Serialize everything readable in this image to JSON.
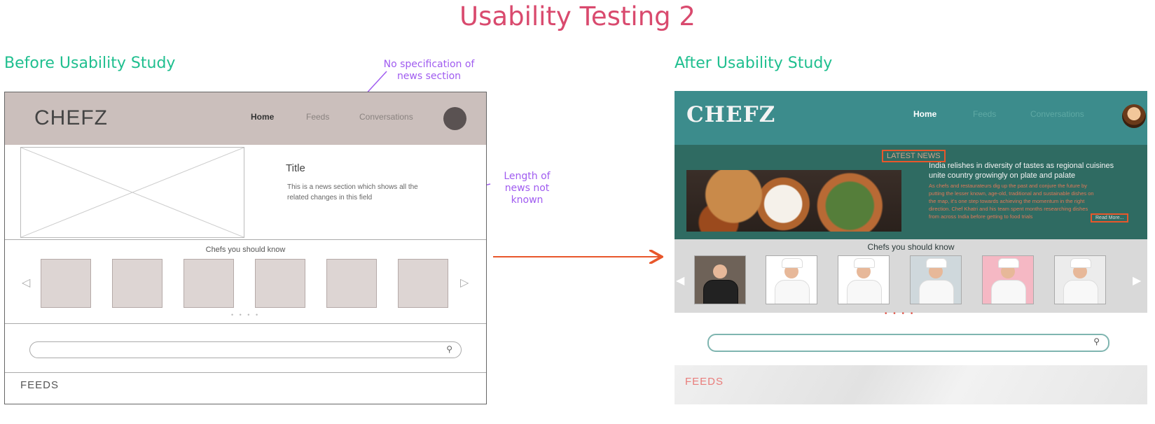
{
  "page_title": "Usability Testing 2",
  "before": {
    "heading": "Before Usability Study",
    "logo": "CHEFZ",
    "nav": [
      "Home",
      "Feeds",
      "Conversations"
    ],
    "news_title": "Title",
    "news_body": "This is a news section which shows all the related changes in this field",
    "chefs_title": "Chefs you should know",
    "dots": "• • • •",
    "feeds_label": "FEEDS"
  },
  "annotations": {
    "no_spec": "No specification of news section",
    "length": "Length of news not known"
  },
  "after": {
    "heading": "After Usability Study",
    "logo": "CHEFZ",
    "nav": [
      "Home",
      "Feeds",
      "Conversations"
    ],
    "latest_news_label": "LATEST NEWS",
    "news_headline": "India relishes in diversity of tastes as regional cuisines unite country growingly on plate and palate",
    "news_body": "As chefs and restaurateurs dig up the past and conjure the future by putting the lesser known, age-old, traditional and sustainable dishes on the map, it's one step towards achieving the momentum in the right direction. Chef Khatri and his team spent months researching dishes from across India before getting to food trials",
    "read_more": "Read More...",
    "chefs_title": "Chefs you should know",
    "dots": "• • • •",
    "feeds_label": "FEEDS"
  },
  "icons": {
    "search": "search-icon",
    "arrow_left": "chevron-left-icon",
    "arrow_right": "chevron-right-icon",
    "transition": "arrow-right-icon"
  },
  "colors": {
    "title": "#d94a6e",
    "section_heading": "#1fbf8f",
    "annotation": "#a05cf0",
    "arrow": "#e8572b",
    "after_header": "#3c8c8c",
    "after_news": "#2f6b62"
  }
}
